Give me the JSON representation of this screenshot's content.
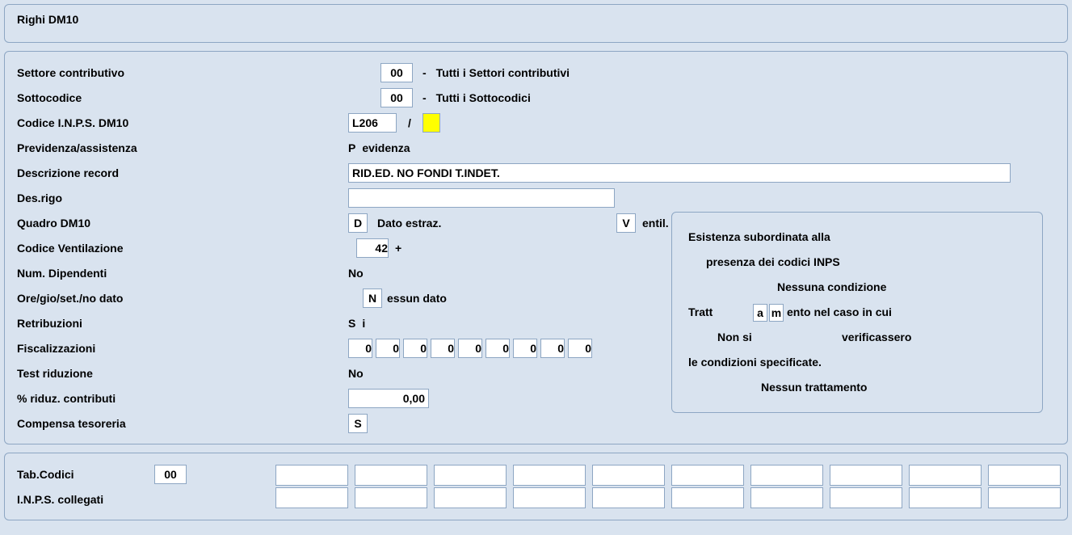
{
  "header": {
    "title": "Righi DM10"
  },
  "fields": {
    "settore": {
      "label": "Settore contributivo",
      "code": "00",
      "desc": "Tutti i Settori contributivi"
    },
    "sottocodice": {
      "label": "Sottocodice",
      "code": "00",
      "desc": "Tutti i Sottocodici"
    },
    "codice_inps": {
      "label": "Codice I.N.P.S. DM10",
      "code": "L206",
      "suffix": ""
    },
    "previdenza": {
      "label": "Previdenza/assistenza",
      "code": "P",
      "desc": "evidenza"
    },
    "descrizione": {
      "label": "Descrizione record",
      "value": "RID.ED. NO FONDI T.INDET."
    },
    "desrigo": {
      "label": "Des.rigo",
      "value": ""
    },
    "quadro": {
      "label": "Quadro DM10",
      "d": "D",
      "dlabel": "Dato estraz.",
      "v": "V",
      "vlabel": "entil."
    },
    "ventilazione": {
      "label": "Codice Ventilazione",
      "value": "42"
    },
    "numdip": {
      "label": "Num. Dipendenti",
      "value": "No"
    },
    "ore": {
      "label": "Ore/gio/set./no dato",
      "code": "N",
      "desc": "essun dato"
    },
    "retribuzioni": {
      "label": "Retribuzioni",
      "code": "S",
      "desc": "i"
    },
    "fiscalizzazioni": {
      "label": "Fiscalizzazioni",
      "values": [
        "0",
        "0",
        "0",
        "0",
        "0",
        "0",
        "0",
        "0",
        "0"
      ]
    },
    "testrid": {
      "label": "Test riduzione",
      "value": "No"
    },
    "riduz": {
      "label": "% riduz. contributi",
      "value": "0,00"
    },
    "compensa": {
      "label": "Compensa tesoreria",
      "code": "S"
    }
  },
  "side": {
    "line1": "Esistenza subordinata alla",
    "line2": "presenza dei codici INPS",
    "line3": "Nessuna condizione",
    "line4a": "Tratt",
    "line4code1": "a",
    "line4code2": "m",
    "line4b": "ento nel caso in cui",
    "line5a": "Non si",
    "line5b": "verificassero",
    "line6": "le condizioni specificate.",
    "line7": "Nessun trattamento"
  },
  "bottom": {
    "tab_label": "Tab.Codici",
    "tab_value": "00",
    "inps_label": "I.N.P.S. collegati"
  }
}
